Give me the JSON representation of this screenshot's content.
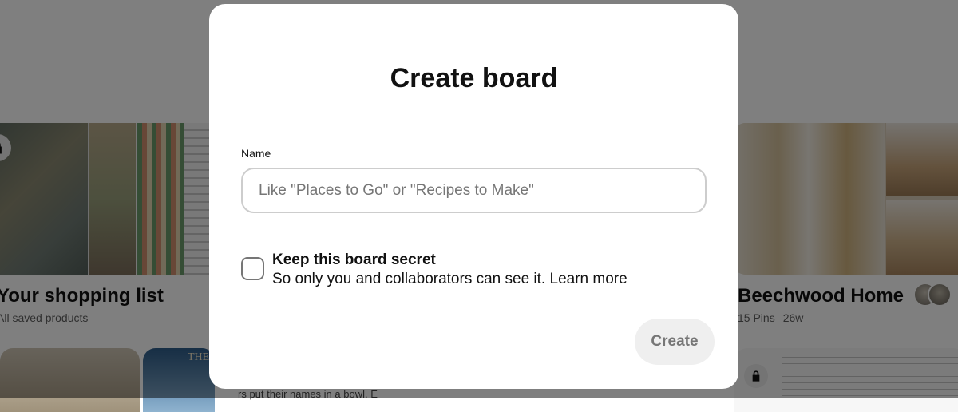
{
  "background": {
    "boards": [
      {
        "title": "Your shopping list",
        "subtitle": "All saved products"
      },
      {
        "title": "Beechwood Home",
        "pins": "15 Pins",
        "age": "26w"
      }
    ],
    "row2_text_fragment": "rs put their names in a bowl. E",
    "row2_sign_text": "THE"
  },
  "modal": {
    "title": "Create board",
    "name_label": "Name",
    "name_placeholder": "Like \"Places to Go\" or \"Recipes to Make\"",
    "name_value": "",
    "secret": {
      "checked": false,
      "title": "Keep this board secret",
      "description": "So only you and collaborators can see it.",
      "link": "Learn more"
    },
    "create_label": "Create"
  },
  "colors": {
    "overlay": "rgba(0,0,0,0.5)",
    "button_disabled_bg": "#efefef",
    "button_disabled_text": "#767676"
  }
}
